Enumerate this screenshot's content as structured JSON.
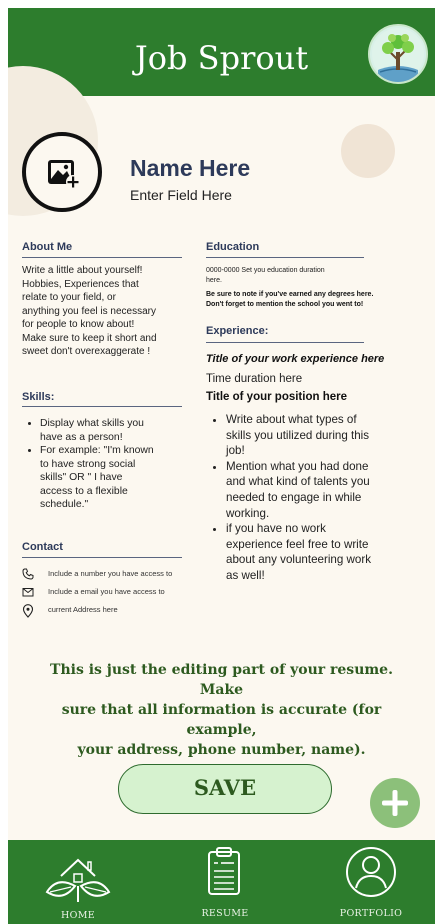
{
  "app": {
    "title": "Job Sprout",
    "logo_icon": "tree-logo-icon"
  },
  "profile": {
    "name": "Name Here",
    "field": "Enter Field Here",
    "avatar_icon": "add-photo-icon"
  },
  "about": {
    "heading": "About Me",
    "lines": [
      "Write a little about yourself!",
      "Hobbies, Experiences that",
      "relate to your field, or",
      "anything you feel is necessary",
      "for people to know about!",
      "Make sure to keep it short and",
      "sweet don't overexaggerate !"
    ]
  },
  "skills": {
    "heading": "Skills:",
    "items": [
      {
        "lines": [
          "Display what skills you",
          "have as a person!"
        ]
      },
      {
        "lines": [
          "For example: \"I'm known",
          "to have strong social",
          "skills\" OR \" I have",
          "access to a flexible",
          "schedule.\""
        ]
      }
    ]
  },
  "contact": {
    "heading": "Contact",
    "phone": "Include a number you have access to",
    "email": "Include a email you have access to",
    "address": "current Address here"
  },
  "education": {
    "heading": "Education",
    "lines": [
      "0000-0000 Set you education duration",
      "here."
    ],
    "bold_lines": [
      "Be sure to note if you've earned any degrees here.",
      "Don't forget to mention the school you went to!"
    ]
  },
  "experience": {
    "heading": "Experience:",
    "title": "Title of your work experience here",
    "time": "Time duration here",
    "position": "Title of your position here",
    "items": [
      {
        "lines": [
          "Write about what types of",
          "skills you utilized during this",
          "job!"
        ]
      },
      {
        "lines": [
          "Mention what you had done",
          "and what kind of talents you",
          "needed to engage in while",
          "working."
        ]
      },
      {
        "lines": [
          "if you have no work",
          "experience feel free to write",
          "about any volunteering work",
          "as well!"
        ]
      }
    ]
  },
  "note": {
    "lines": [
      "This is just the editing part of your resume. Make",
      "sure that all information is accurate (for example,",
      "your address, phone number, name)."
    ]
  },
  "actions": {
    "save_label": "SAVE",
    "add_icon": "plus-icon"
  },
  "nav": {
    "items": [
      {
        "label": "HOME",
        "icon": "home-leaves-icon"
      },
      {
        "label": "RESUME",
        "icon": "resume-document-icon"
      },
      {
        "label": "PORTFOLIO",
        "icon": "user-profile-icon"
      }
    ]
  },
  "colors": {
    "header_green": "#2d7d2d",
    "background": "#fcf8f0",
    "accent_navy": "#2d3a5a",
    "button_fill": "#d6f2cf",
    "fab_green": "#8cc07a"
  }
}
